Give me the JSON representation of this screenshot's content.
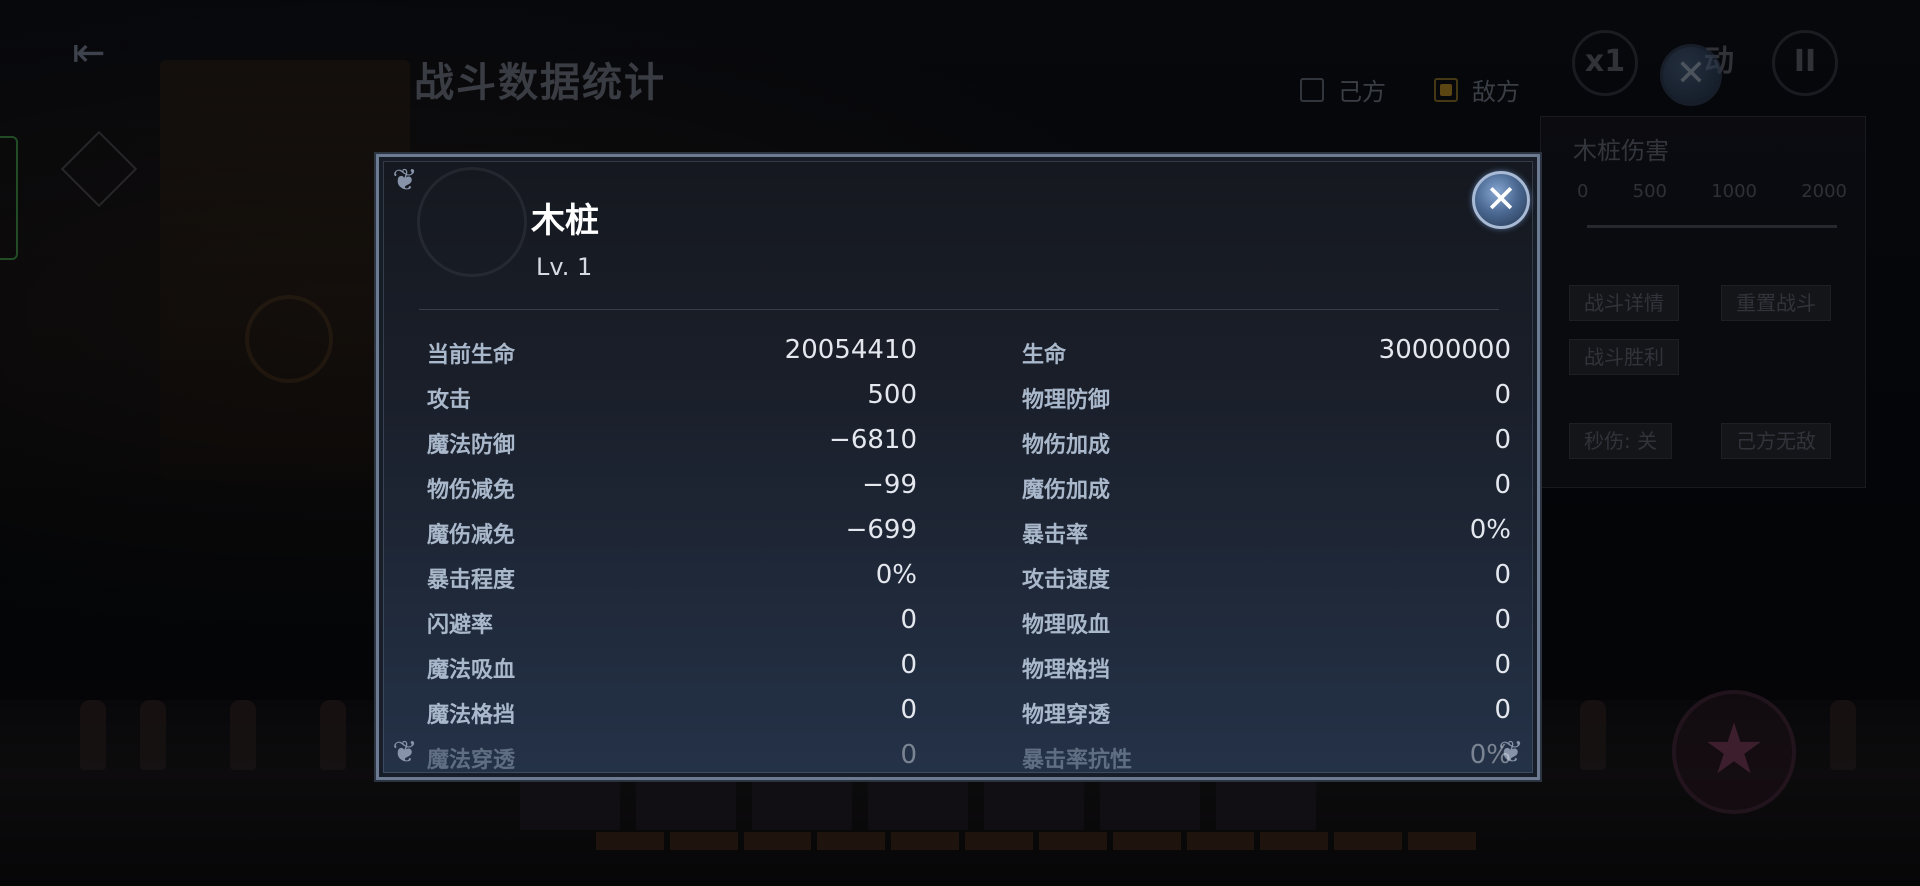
{
  "background": {
    "title": "战斗数据统计",
    "filters": [
      {
        "label": "己方",
        "checked": false
      },
      {
        "label": "敌方",
        "checked": true
      }
    ],
    "speed_label": "x1",
    "auto_label": "动",
    "pause_label": "II",
    "side_panel": {
      "title": "木桩伤害",
      "ticks": [
        "0",
        "500",
        "1000",
        "2000"
      ],
      "buttons": [
        "战斗详情",
        "重置战斗",
        "战斗胜利",
        "秒伤: 关",
        "己方无敌"
      ]
    }
  },
  "modal": {
    "name": "木桩",
    "level": "Lv. 1",
    "close_icon": "close-icon",
    "stats": [
      {
        "left_label": "当前生命",
        "left_value": "20054410",
        "right_label": "生命",
        "right_value": "30000000"
      },
      {
        "left_label": "攻击",
        "left_value": "500",
        "right_label": "物理防御",
        "right_value": "0"
      },
      {
        "left_label": "魔法防御",
        "left_value": "−6810",
        "right_label": "物伤加成",
        "right_value": "0"
      },
      {
        "left_label": "物伤减免",
        "left_value": "−99",
        "right_label": "魔伤加成",
        "right_value": "0"
      },
      {
        "left_label": "魔伤减免",
        "left_value": "−699",
        "right_label": "暴击率",
        "right_value": "0%"
      },
      {
        "left_label": "暴击程度",
        "left_value": "0%",
        "right_label": "攻击速度",
        "right_value": "0"
      },
      {
        "left_label": "闪避率",
        "left_value": "0",
        "right_label": "物理吸血",
        "right_value": "0"
      },
      {
        "left_label": "魔法吸血",
        "left_value": "0",
        "right_label": "物理格挡",
        "right_value": "0"
      },
      {
        "left_label": "魔法格挡",
        "left_value": "0",
        "right_label": "物理穿透",
        "right_value": "0"
      },
      {
        "left_label": "魔法穿透",
        "left_value": "0",
        "right_label": "暴击率抗性",
        "right_value": "0%"
      }
    ]
  },
  "colors": {
    "accent_gold": "#8a6a1e",
    "modal_border": "#6d7b92",
    "label_color": "#aab8cc"
  }
}
